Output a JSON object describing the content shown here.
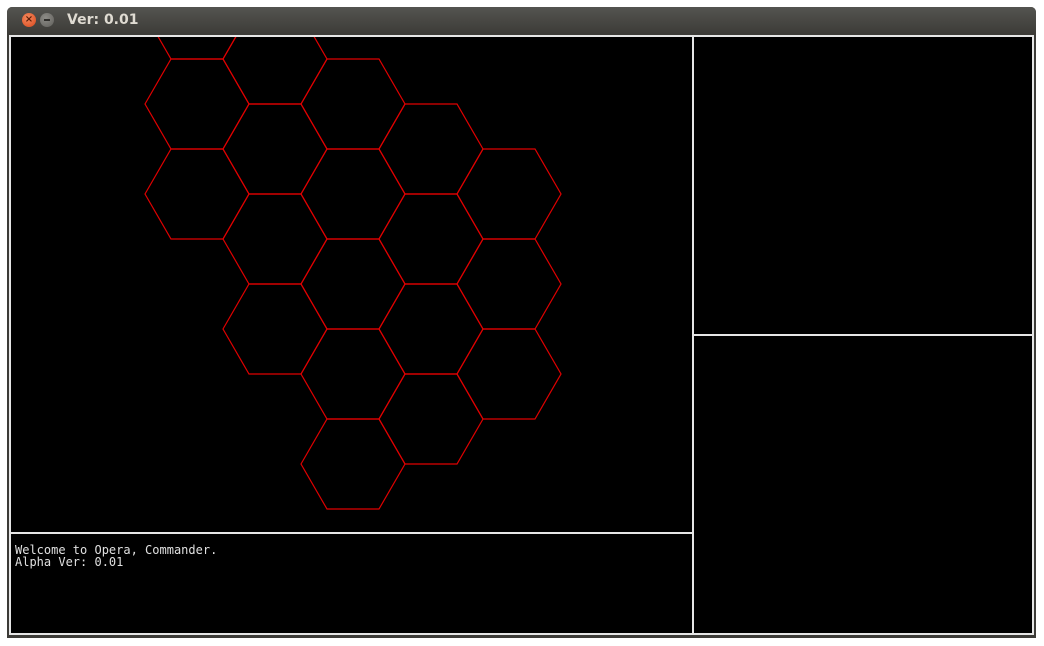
{
  "window": {
    "title": "Ver: 0.01",
    "close_glyph": "×",
    "icons": [
      "close-icon",
      "minimize-icon"
    ]
  },
  "hex_map": {
    "stroke_color": "#e00000",
    "background": "#000000",
    "hexes": [
      {
        "col": -2,
        "row": -2
      },
      {
        "col": -2,
        "row": -1
      },
      {
        "col": -2,
        "row": 0
      },
      {
        "col": -1,
        "row": -2
      },
      {
        "col": -1,
        "row": -1
      },
      {
        "col": -1,
        "row": 0
      },
      {
        "col": -1,
        "row": 1
      },
      {
        "col": 0,
        "row": -2
      },
      {
        "col": 0,
        "row": -1
      },
      {
        "col": 0,
        "row": 0
      },
      {
        "col": 0,
        "row": 1
      },
      {
        "col": 0,
        "row": 2
      },
      {
        "col": 1,
        "row": -2
      },
      {
        "col": 1,
        "row": -1
      },
      {
        "col": 1,
        "row": 0
      },
      {
        "col": 1,
        "row": 1
      },
      {
        "col": 2,
        "row": -2
      },
      {
        "col": 2,
        "row": -1
      },
      {
        "col": 2,
        "row": 0
      }
    ]
  },
  "console": {
    "lines": [
      "Welcome to Opera, Commander.",
      "Alpha Ver: 0.01"
    ]
  }
}
